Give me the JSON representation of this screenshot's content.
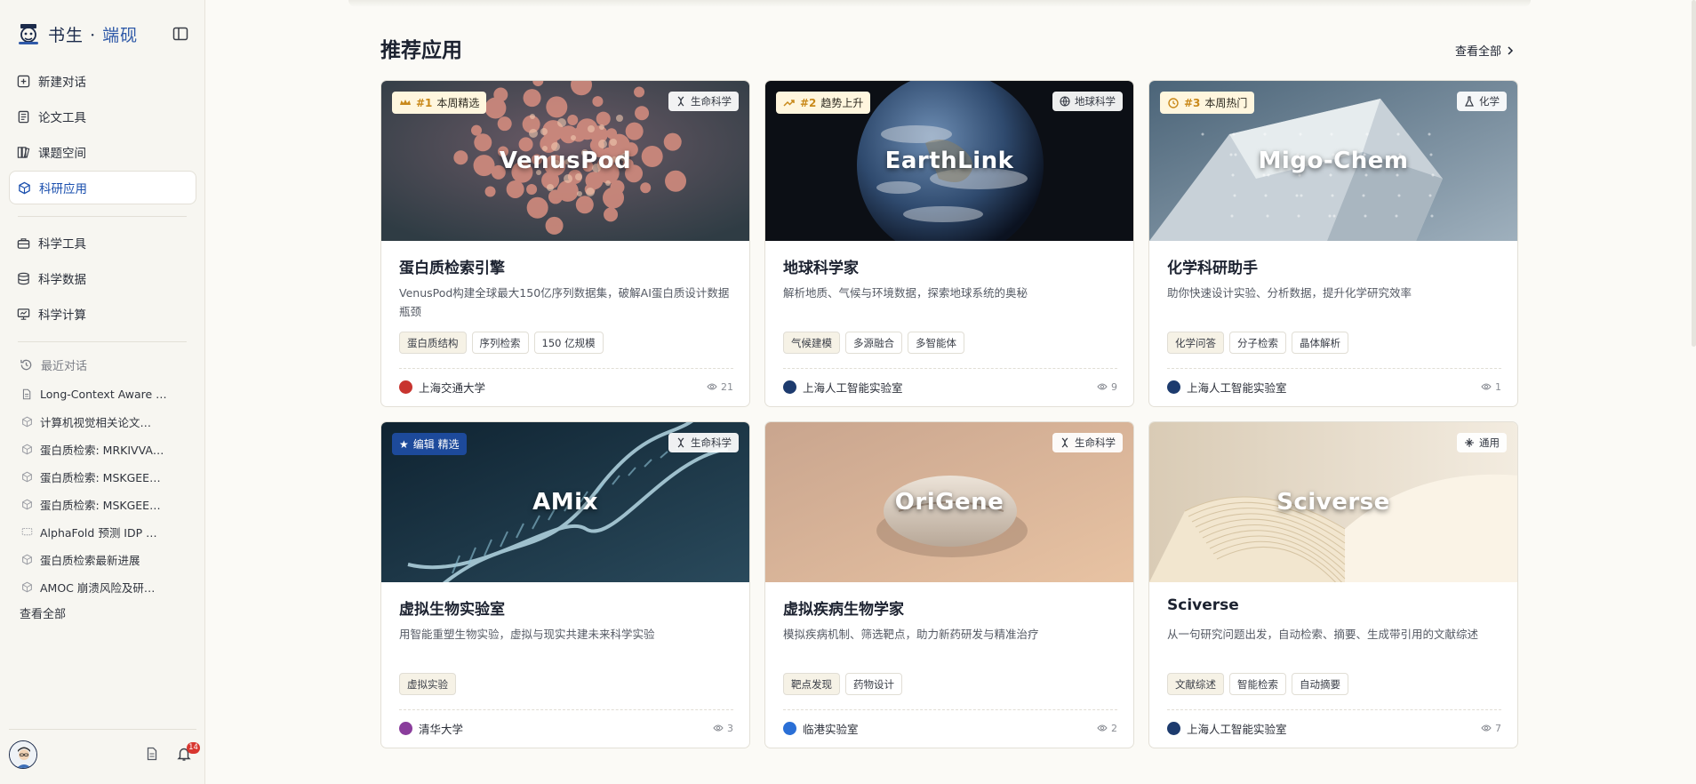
{
  "brand": {
    "name_left": "书生",
    "separator": "·",
    "name_right": "端砚"
  },
  "nav": {
    "primary": [
      {
        "label": "新建对话",
        "icon": "plus-square-icon"
      },
      {
        "label": "论文工具",
        "icon": "document-icon"
      },
      {
        "label": "课题空间",
        "icon": "books-icon"
      },
      {
        "label": "科研应用",
        "icon": "cube-icon",
        "active": true
      }
    ],
    "secondary": [
      {
        "label": "科学工具",
        "icon": "toolbox-icon"
      },
      {
        "label": "科学数据",
        "icon": "database-icon"
      },
      {
        "label": "科学计算",
        "icon": "monitor-icon"
      }
    ]
  },
  "recent": {
    "heading": "最近对话",
    "items": [
      {
        "label": "Long-Context Aware …",
        "icon": "document-icon"
      },
      {
        "label": "计算机视觉相关论文…",
        "icon": "cube-icon"
      },
      {
        "label": "蛋白质检索: MRKIVVA…",
        "icon": "cube-icon"
      },
      {
        "label": "蛋白质检索: MSKGEE…",
        "icon": "cube-icon"
      },
      {
        "label": "蛋白质检索: MSKGEE…",
        "icon": "cube-icon"
      },
      {
        "label": "AlphaFold 预测 IDP …",
        "icon": "chat-icon"
      },
      {
        "label": "蛋白质检索最新进展",
        "icon": "cube-icon"
      },
      {
        "label": "AMOC 崩溃风险及研…",
        "icon": "cube-icon"
      }
    ],
    "view_all": "查看全部"
  },
  "notifications": {
    "count": "14"
  },
  "main": {
    "section_title": "推荐应用",
    "view_all": "查看全部"
  },
  "cards": [
    {
      "image_title": "VenusPod",
      "rank_num": "#1",
      "rank_label": "本周精选",
      "rank_icon": "crown-icon",
      "category": "生命科学",
      "category_icon": "dna-icon",
      "title": "蛋白质检索引擎",
      "desc": "VenusPod构建全球最大150亿序列数据集，破解AI蛋白质设计数据瓶颈",
      "tags": [
        "蛋白质结构",
        "序列检索",
        "150 亿规模"
      ],
      "org": "上海交通大学",
      "views": "21",
      "colors": {
        "bg1": "#6b5a66",
        "bg2": "#2f3c44",
        "org": "#c8342f"
      }
    },
    {
      "image_title": "EarthLink",
      "rank_num": "#2",
      "rank_label": "趋势上升",
      "rank_icon": "trend-icon",
      "category": "地球科学",
      "category_icon": "globe-icon",
      "title": "地球科学家",
      "desc": "解析地质、气候与环境数据，探索地球系统的奥秘",
      "tags": [
        "气候建模",
        "多源融合",
        "多智能体"
      ],
      "org": "上海人工智能实验室",
      "views": "9",
      "colors": {
        "bg1": "#1b2230",
        "bg2": "#0c0f15",
        "org": "#1d3b6e"
      }
    },
    {
      "image_title": "Migo-Chem",
      "rank_num": "#3",
      "rank_label": "本周热门",
      "rank_icon": "clock-icon",
      "category": "化学",
      "category_icon": "flask-icon",
      "title": "化学科研助手",
      "desc": "助你快速设计实验、分析数据，提升化学研究效率",
      "tags": [
        "化学问答",
        "分子检索",
        "晶体解析"
      ],
      "org": "上海人工智能实验室",
      "views": "1",
      "colors": {
        "bg1": "#4b6478",
        "bg2": "#c8d1d8",
        "org": "#1d3b6e"
      }
    },
    {
      "image_title": "AMix",
      "rank_num": "★",
      "rank_label": "编辑 精选",
      "rank_icon": "star-icon",
      "rank_style": "blue",
      "category": "生命科学",
      "category_icon": "dna-icon",
      "title": "虚拟生物实验室",
      "desc": "用智能重塑生物实验，虚拟与现实共建未来科学实验",
      "tags": [
        "虚拟实验"
      ],
      "org": "清华大学",
      "views": "3",
      "colors": {
        "bg1": "#0f2331",
        "bg2": "#2a4a5c",
        "org": "#8a3d9c"
      }
    },
    {
      "image_title": "OriGene",
      "rank_num": "",
      "rank_label": "",
      "category": "生命科学",
      "category_icon": "dna-icon",
      "title": "虚拟疾病生物学家",
      "desc": "模拟疾病机制、筛选靶点，助力新药研发与精准治疗",
      "tags": [
        "靶点发现",
        "药物设计"
      ],
      "org": "临港实验室",
      "views": "2",
      "colors": {
        "bg1": "#c9a58e",
        "bg2": "#e8c3a3",
        "org": "#2a6fd6"
      }
    },
    {
      "image_title": "Sciverse",
      "rank_num": "",
      "rank_label": "",
      "category": "通用",
      "category_icon": "sparkle-icon",
      "title": "Sciverse",
      "desc": "从一句研究问题出发，自动检索、摘要、生成带引用的文献综述",
      "tags": [
        "文献综述",
        "智能检索",
        "自动摘要"
      ],
      "org": "上海人工智能实验室",
      "views": "7",
      "colors": {
        "bg1": "#d9cbb5",
        "bg2": "#f3ece0",
        "org": "#1d3b6e"
      }
    }
  ]
}
